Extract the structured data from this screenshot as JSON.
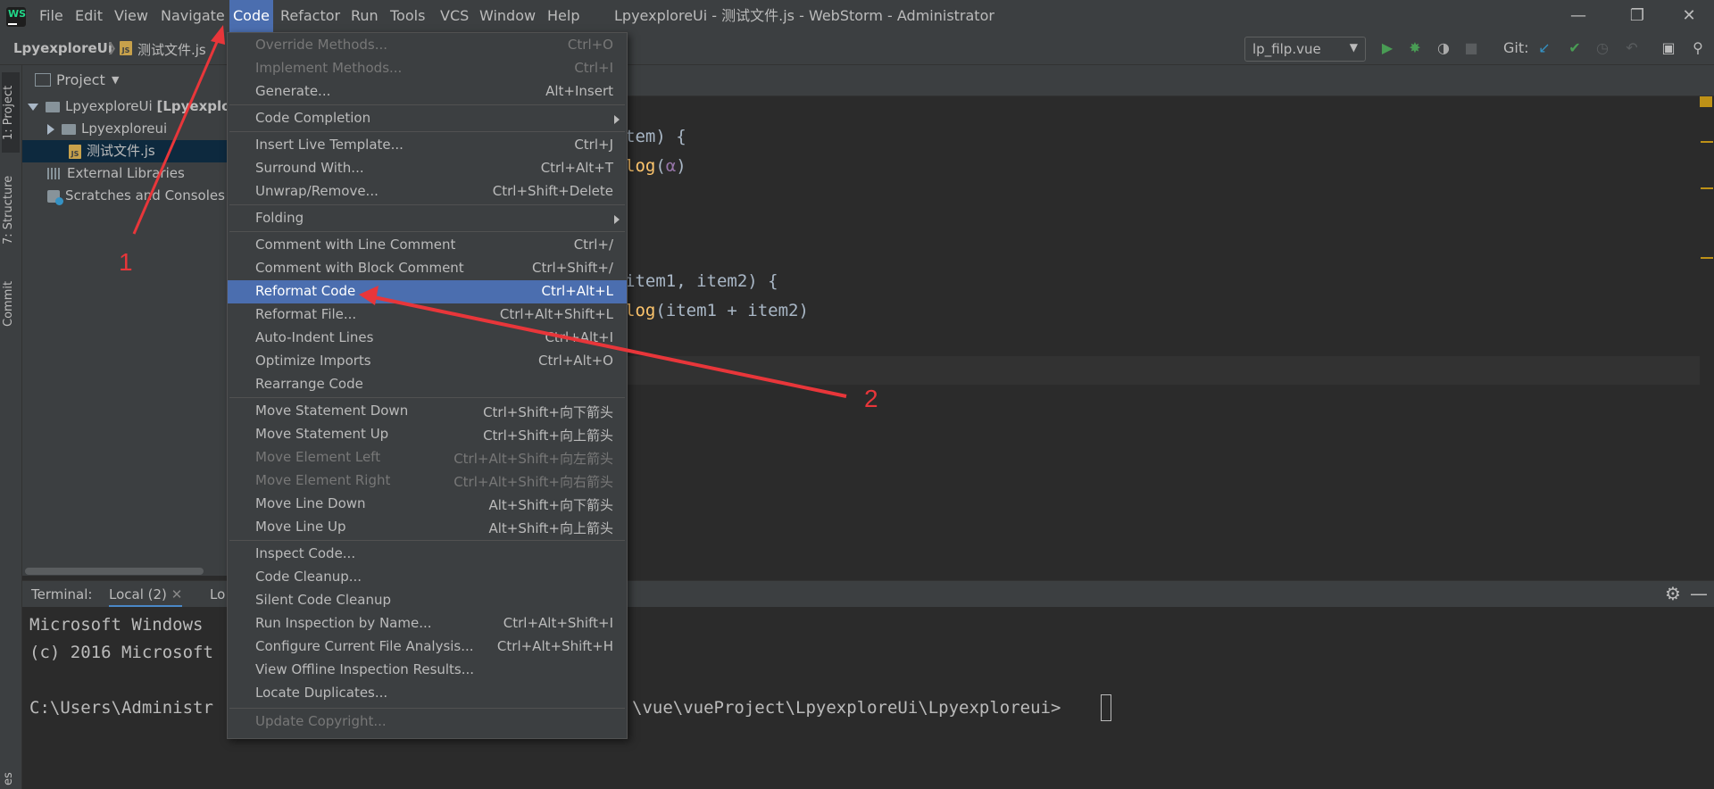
{
  "titlebar": {
    "menus": [
      "File",
      "Edit",
      "View",
      "Navigate",
      "Code",
      "Refactor",
      "Run",
      "Tools",
      "VCS",
      "Window",
      "Help"
    ],
    "window_title": "LpyexploreUi - 测试文件.js - WebStorm - Administrator",
    "app_logo_text": "WS"
  },
  "navbar": {
    "project": "LpyexploreUi",
    "file": "测试文件.js",
    "run_config": "lp_filp.vue",
    "git_label": "Git:"
  },
  "left_tabs": {
    "project": "1: Project",
    "structure": "7: Structure",
    "commit": "Commit",
    "bottom": "es"
  },
  "project_panel": {
    "header": "Project",
    "tree": [
      {
        "label": "LpyexploreUi",
        "bold": "[Lpyexplo"
      },
      {
        "label": "Lpyexploreui"
      },
      {
        "label": "测试文件.js"
      },
      {
        "label": "External Libraries"
      },
      {
        "label": "Scratches and Consoles"
      }
    ]
  },
  "editor": {
    "lines": [
      {
        "a": "tem) {",
        "b": ""
      },
      {
        "fn": "log",
        "rest": "(",
        "greek": "α",
        "end": ")"
      },
      {
        "a": "item1, item2) {"
      },
      {
        "fn": "log",
        "rest": "(item1 + item2)"
      }
    ]
  },
  "terminal": {
    "label": "Terminal:",
    "tabs": [
      "Local (2)",
      "Lo"
    ],
    "lines": [
      "Microsoft Windows",
      "(c) 2016 Microsoft",
      "",
      "C:\\Users\\Administr"
    ],
    "path_tail": "\\vue\\vueProject\\LpyexploreUi\\Lpyexploreui>"
  },
  "code_menu": {
    "items": [
      {
        "label": "Override Methods...",
        "shortcut": "Ctrl+O",
        "disabled": true
      },
      {
        "label": "Implement Methods...",
        "shortcut": "Ctrl+I",
        "disabled": true
      },
      {
        "label": "Generate...",
        "shortcut": "Alt+Insert"
      },
      {
        "label": "Code Completion",
        "shortcut": ""
      },
      {
        "label": "Insert Live Template...",
        "shortcut": "Ctrl+J"
      },
      {
        "label": "Surround With...",
        "shortcut": "Ctrl+Alt+T"
      },
      {
        "label": "Unwrap/Remove...",
        "shortcut": "Ctrl+Shift+Delete"
      },
      {
        "label": "Folding",
        "shortcut": ""
      },
      {
        "label": "Comment with Line Comment",
        "shortcut": "Ctrl+/"
      },
      {
        "label": "Comment with Block Comment",
        "shortcut": "Ctrl+Shift+/"
      },
      {
        "label": "Reformat Code",
        "shortcut": "Ctrl+Alt+L",
        "highlighted": true
      },
      {
        "label": "Reformat File...",
        "shortcut": "Ctrl+Alt+Shift+L"
      },
      {
        "label": "Auto-Indent Lines",
        "shortcut": "Ctrl+Alt+I"
      },
      {
        "label": "Optimize Imports",
        "shortcut": "Ctrl+Alt+O"
      },
      {
        "label": "Rearrange Code",
        "shortcut": ""
      },
      {
        "label": "Move Statement Down",
        "shortcut": "Ctrl+Shift+向下箭头"
      },
      {
        "label": "Move Statement Up",
        "shortcut": "Ctrl+Shift+向上箭头"
      },
      {
        "label": "Move Element Left",
        "shortcut": "Ctrl+Alt+Shift+向左箭头",
        "disabled": true
      },
      {
        "label": "Move Element Right",
        "shortcut": "Ctrl+Alt+Shift+向右箭头",
        "disabled": true
      },
      {
        "label": "Move Line Down",
        "shortcut": "Alt+Shift+向下箭头"
      },
      {
        "label": "Move Line Up",
        "shortcut": "Alt+Shift+向上箭头"
      },
      {
        "label": "Inspect Code...",
        "shortcut": ""
      },
      {
        "label": "Code Cleanup...",
        "shortcut": ""
      },
      {
        "label": "Silent Code Cleanup",
        "shortcut": ""
      },
      {
        "label": "Run Inspection by Name...",
        "shortcut": "Ctrl+Alt+Shift+I"
      },
      {
        "label": "Configure Current File Analysis...",
        "shortcut": "Ctrl+Alt+Shift+H"
      },
      {
        "label": "View Offline Inspection Results...",
        "shortcut": ""
      },
      {
        "label": "Locate Duplicates...",
        "shortcut": ""
      },
      {
        "label": "Update Copyright...",
        "shortcut": "",
        "disabled": true
      }
    ]
  },
  "annotations": {
    "first": "1",
    "second": "2"
  },
  "colors": {
    "accent": "#4b6eaf",
    "annotation": "#e8363a",
    "run": "#499c54",
    "git": "#3592c4"
  }
}
